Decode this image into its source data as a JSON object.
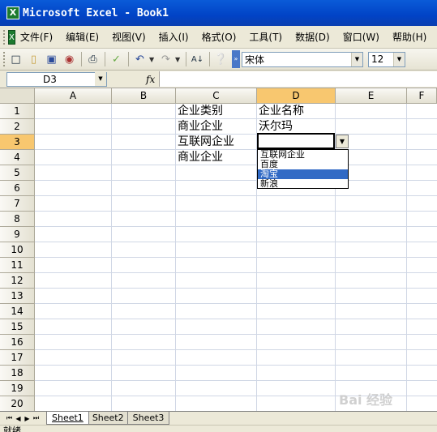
{
  "window": {
    "title": "Microsoft Excel - Book1"
  },
  "menu": [
    "文件(F)",
    "编辑(E)",
    "视图(V)",
    "插入(I)",
    "格式(O)",
    "工具(T)",
    "数据(D)",
    "窗口(W)",
    "帮助(H)"
  ],
  "toolbar": {
    "font_name": "宋体",
    "font_size": "12"
  },
  "formula_bar": {
    "name_box": "D3",
    "fx_label": "fx",
    "content": ""
  },
  "columns": [
    "C",
    "D",
    "E",
    "F"
  ],
  "columns_ab": [
    "A",
    "B"
  ],
  "rows": [
    "1",
    "2",
    "3",
    "4",
    "5",
    "6",
    "7",
    "8",
    "9",
    "10",
    "11",
    "12",
    "13",
    "14",
    "15",
    "16",
    "17",
    "18",
    "19",
    "20"
  ],
  "cells": {
    "C1": "企业类别",
    "D1": "企业名称",
    "C2": "商业企业",
    "D2": "沃尔玛",
    "C3": "互联网企业",
    "D3": "",
    "C4": "商业企业"
  },
  "dropdown": {
    "options": [
      "互联网企业",
      "百度",
      "淘宝",
      "新浪"
    ],
    "highlighted": "淘宝"
  },
  "sheets": [
    "Sheet1",
    "Sheet2",
    "Sheet3"
  ],
  "active_sheet": "Sheet1",
  "status": "就绪",
  "watermark": "Bai 经验"
}
